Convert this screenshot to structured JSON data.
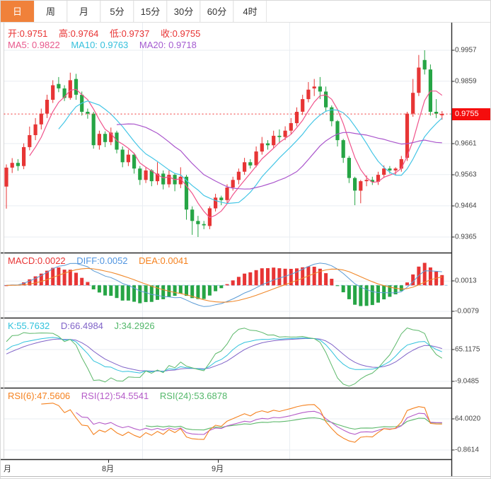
{
  "tabs": {
    "items": [
      {
        "label": "日",
        "active": true
      },
      {
        "label": "周",
        "active": false
      },
      {
        "label": "月",
        "active": false
      },
      {
        "label": "5分",
        "active": false
      },
      {
        "label": "15分",
        "active": false
      },
      {
        "label": "30分",
        "active": false
      },
      {
        "label": "60分",
        "active": false
      },
      {
        "label": "4时",
        "active": false
      }
    ]
  },
  "legends": {
    "ohlc": {
      "open": "开:0.9751",
      "high": "高:0.9764",
      "low": "低:0.9737",
      "close": "收:0.9755"
    },
    "ma": {
      "ma5": "MA5: 0.9822",
      "ma10": "MA10: 0.9763",
      "ma20": "MA20: 0.9718"
    },
    "macd": {
      "macd": "MACD:0.0022",
      "diff": "DIFF:0.0052",
      "dea": "DEA:0.0041"
    },
    "kdj": {
      "k": "K:55.7632",
      "d": "D:66.4984",
      "j": "J:34.2926"
    },
    "rsi": {
      "rsi6": "RSI(6):47.5606",
      "rsi12": "RSI(12):54.5541",
      "rsi24": "RSI(24):53.6878"
    }
  },
  "axes": {
    "main_y": [
      "0.9957",
      "0.9859",
      "0.9661",
      "0.9563",
      "0.9464",
      "0.9365"
    ],
    "price_tag": "0.9755",
    "macd_y": [
      "0.0013",
      "-0.0079"
    ],
    "kdj_y": [
      "65.1175",
      "-9.0485"
    ],
    "rsi_y": [
      "64.0020",
      "-0.8614"
    ],
    "x_labels": [
      "月",
      "8月",
      "9月"
    ]
  },
  "colors": {
    "tab_active_bg": "#f0813a",
    "candle_up": "#e73535",
    "candle_down": "#26a545",
    "price_tag_bg": "#f50d0d",
    "price_line": "#f23030",
    "ma5": "#f0548c",
    "ma10": "#45c6e6",
    "ma20": "#aa55cc",
    "macd_diff": "#5b9bd5",
    "macd_dea": "#f0882a",
    "macd_zero_dash": "#8fc1e8",
    "kdj_k": "#2fc2dc",
    "kdj_d": "#8063c8",
    "kdj_j": "#5cb86a",
    "rsi6": "#f5811e",
    "rsi12": "#b55bc8",
    "rsi24": "#5cb86a",
    "grid": "#e9edf2",
    "separator": "#2a2a2a"
  },
  "chart_data": [
    {
      "type": "candlestick",
      "panel": "price",
      "interval": "日",
      "x_tick_labels": [
        "月",
        "8月",
        "9月"
      ],
      "y_tick_labels": [
        0.9957,
        0.9859,
        0.9661,
        0.9563,
        0.9464,
        0.9365
      ],
      "ylim": [
        0.9365,
        0.9957
      ],
      "current_price": 0.9755,
      "ohlc": {
        "open": 0.9751,
        "high": 0.9764,
        "low": 0.9737,
        "close": 0.9755
      },
      "ma": {
        "MA5": 0.9822,
        "MA10": 0.9763,
        "MA20": 0.9718
      },
      "up_color_means": "close >= open (red)",
      "candle_format": [
        "open",
        "close",
        "low",
        "high"
      ],
      "candles": [
        [
          0.9525,
          0.9585,
          0.9455,
          0.9595
        ],
        [
          0.9585,
          0.96,
          0.9568,
          0.9615
        ],
        [
          0.96,
          0.959,
          0.9575,
          0.9612
        ],
        [
          0.959,
          0.965,
          0.958,
          0.9662
        ],
        [
          0.965,
          0.9688,
          0.964,
          0.9715
        ],
        [
          0.9688,
          0.9722,
          0.9672,
          0.9742
        ],
        [
          0.9722,
          0.9756,
          0.9706,
          0.9772
        ],
        [
          0.9756,
          0.98,
          0.9742,
          0.9816
        ],
        [
          0.98,
          0.9846,
          0.979,
          0.9862
        ],
        [
          0.985,
          0.9836,
          0.9824,
          0.9872
        ],
        [
          0.9836,
          0.9806,
          0.9796,
          0.9846
        ],
        [
          0.9806,
          0.9862,
          0.98,
          0.9886
        ],
        [
          0.9866,
          0.9816,
          0.98,
          0.9882
        ],
        [
          0.9816,
          0.9762,
          0.975,
          0.9826
        ],
        [
          0.9762,
          0.9756,
          0.974,
          0.9772
        ],
        [
          0.9756,
          0.9656,
          0.9645,
          0.9762
        ],
        [
          0.9656,
          0.9692,
          0.9642,
          0.9702
        ],
        [
          0.9692,
          0.9666,
          0.965,
          0.97
        ],
        [
          0.9666,
          0.9696,
          0.9656,
          0.9712
        ],
        [
          0.9696,
          0.9642,
          0.963,
          0.9702
        ],
        [
          0.9642,
          0.9602,
          0.9586,
          0.9652
        ],
        [
          0.9602,
          0.9626,
          0.959,
          0.9642
        ],
        [
          0.9626,
          0.9582,
          0.9566,
          0.9632
        ],
        [
          0.9582,
          0.9546,
          0.953,
          0.959
        ],
        [
          0.9546,
          0.9576,
          0.9536,
          0.9586
        ],
        [
          0.9576,
          0.9542,
          0.9526,
          0.958
        ],
        [
          0.9542,
          0.9566,
          0.953,
          0.9602
        ],
        [
          0.9566,
          0.9532,
          0.9516,
          0.9576
        ],
        [
          0.9532,
          0.9562,
          0.9522,
          0.9576
        ],
        [
          0.9562,
          0.9532,
          0.951,
          0.9566
        ],
        [
          0.9532,
          0.9556,
          0.952,
          0.9586
        ],
        [
          0.9556,
          0.9452,
          0.942,
          0.9562
        ],
        [
          0.9452,
          0.9416,
          0.9372,
          0.9462
        ],
        [
          0.9416,
          0.9406,
          0.9365,
          0.9432
        ],
        [
          0.9406,
          0.9402,
          0.939,
          0.9416
        ],
        [
          0.94,
          0.9456,
          0.939,
          0.9462
        ],
        [
          0.9456,
          0.949,
          0.9446,
          0.9502
        ],
        [
          0.949,
          0.9482,
          0.9466,
          0.9496
        ],
        [
          0.9482,
          0.9522,
          0.9472,
          0.9532
        ],
        [
          0.9522,
          0.9546,
          0.9512,
          0.9556
        ],
        [
          0.9546,
          0.9572,
          0.9532,
          0.9582
        ],
        [
          0.9572,
          0.9602,
          0.9562,
          0.9616
        ],
        [
          0.9602,
          0.9592,
          0.9582,
          0.9612
        ],
        [
          0.9592,
          0.9636,
          0.9586,
          0.9652
        ],
        [
          0.9636,
          0.9662,
          0.9626,
          0.9682
        ],
        [
          0.9662,
          0.9656,
          0.9642,
          0.9672
        ],
        [
          0.9656,
          0.9686,
          0.9646,
          0.9702
        ],
        [
          0.9686,
          0.9682,
          0.9662,
          0.9706
        ],
        [
          0.9682,
          0.9702,
          0.9672,
          0.9716
        ],
        [
          0.9702,
          0.9726,
          0.9692,
          0.9742
        ],
        [
          0.9726,
          0.9762,
          0.9716,
          0.9776
        ],
        [
          0.9762,
          0.9802,
          0.9752,
          0.9816
        ],
        [
          0.9802,
          0.9832,
          0.9792,
          0.9856
        ],
        [
          0.9836,
          0.9842,
          0.9812,
          0.9866
        ],
        [
          0.9842,
          0.9826,
          0.9802,
          0.9872
        ],
        [
          0.9826,
          0.9776,
          0.9762,
          0.9842
        ],
        [
          0.9776,
          0.9732,
          0.9716,
          0.9782
        ],
        [
          0.9732,
          0.9672,
          0.9652,
          0.9736
        ],
        [
          0.9672,
          0.9616,
          0.96,
          0.9676
        ],
        [
          0.9616,
          0.9552,
          0.9536,
          0.9622
        ],
        [
          0.9552,
          0.9512,
          0.9466,
          0.9556
        ],
        [
          0.9512,
          0.9542,
          0.9472,
          0.9546
        ],
        [
          0.9542,
          0.9546,
          0.9526,
          0.956
        ],
        [
          0.9546,
          0.954,
          0.953,
          0.9556
        ],
        [
          0.954,
          0.9562,
          0.953,
          0.9572
        ],
        [
          0.9562,
          0.9582,
          0.9552,
          0.9592
        ],
        [
          0.9582,
          0.9576,
          0.9566,
          0.959
        ],
        [
          0.9576,
          0.9582,
          0.956,
          0.9586
        ],
        [
          0.9582,
          0.9612,
          0.9572,
          0.9622
        ],
        [
          0.9616,
          0.9756,
          0.9606,
          0.9762
        ],
        [
          0.9756,
          0.9822,
          0.9746,
          0.9866
        ],
        [
          0.9822,
          0.9902,
          0.9812,
          0.9942
        ],
        [
          0.9926,
          0.9896,
          0.988,
          0.9957
        ],
        [
          0.9896,
          0.9762,
          0.975,
          0.9912
        ],
        [
          0.9762,
          0.9756,
          0.9742,
          0.9802
        ],
        [
          0.9751,
          0.9755,
          0.9737,
          0.9764
        ]
      ]
    },
    {
      "type": "bar",
      "panel": "macd",
      "legend": {
        "MACD": 0.0022,
        "DIFF": 0.0052,
        "DEA": 0.0041
      },
      "y_tick_labels": [
        0.0013,
        -0.0079
      ]
    },
    {
      "type": "line",
      "panel": "kdj",
      "legend": {
        "K": 55.7632,
        "D": 66.4984,
        "J": 34.2926
      },
      "y_tick_labels": [
        65.1175,
        -9.0485
      ]
    },
    {
      "type": "line",
      "panel": "rsi",
      "legend": {
        "RSI6": 47.5606,
        "RSI12": 54.5541,
        "RSI24": 53.6878
      },
      "y_tick_labels": [
        64.002,
        -0.8614
      ]
    }
  ]
}
